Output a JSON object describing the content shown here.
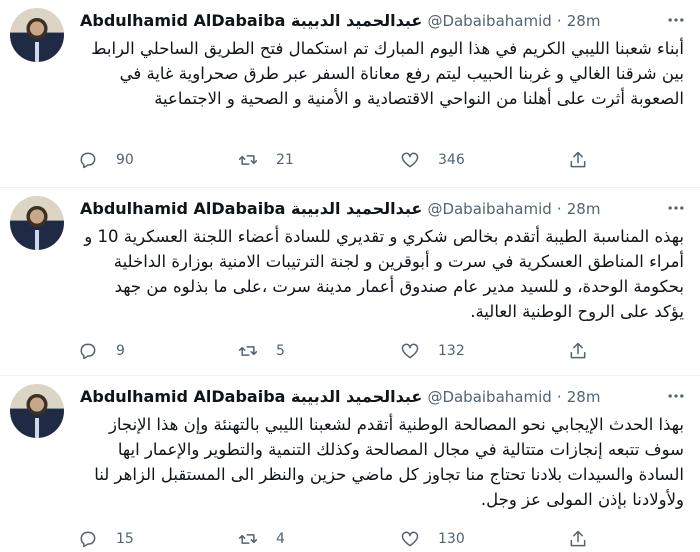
{
  "tweets": [
    {
      "author_name": "Abdulhamid AlDabaiba عبدالحميد الدبيبة",
      "handle": "@Dabaibahamid",
      "separator": "·",
      "time": "28m",
      "text": "أبناء شعبنا الليبي الكريم في هذا اليوم المبارك تم استكمال فتح الطريق الساحلي الرابط بين شرقنا الغالي و غربنا الحبيب ليتم رفع معاناة السفر عبر طرق صحراوية غاية في الصعوبة أثرت على أهلنا من النواحي الاقتصادية و الأمنية و الصحية و الاجتماعية",
      "replies": "90",
      "retweets": "21",
      "likes": "346"
    },
    {
      "author_name": "Abdulhamid AlDabaiba عبدالحميد الدبيبة",
      "handle": "@Dabaibahamid",
      "separator": "·",
      "time": "28m",
      "text": "بهذه المناسبة الطيبة أتقدم بخالص شكري و تقديري للسادة أعضاء اللجنة العسكرية 10 و أمراء المناطق العسكرية في سرت و أبوقرين و لجنة الترتيبات الامنية بوزارة الداخلية بحكومة الوحدة، و للسيد مدير عام صندوق أعمار مدينة سرت ،على ما بذلوه من جهد  يؤكد على الروح الوطنية العالية.",
      "replies": "9",
      "retweets": "5",
      "likes": "132"
    },
    {
      "author_name": "Abdulhamid AlDabaiba عبدالحميد الدبيبة",
      "handle": "@Dabaibahamid",
      "separator": "·",
      "time": "28m",
      "text": "بهذا الحدث الإيجابي نحو المصالحة الوطنية أتقدم لشعبنا الليبي بالتهنئة وإن هذا الإنجاز سوف تتبعه إنجازات متتالية في مجال المصالحة وكذلك التنمية والتطوير والإعمار ايها السادة والسيدات بلادنا تحتاج منا تجاوز كل ماضي حزين والنظر الى المستقبل الزاهر لنا ولأولادنا بإذن المولى عز وجل.",
      "replies": "15",
      "retweets": "4",
      "likes": "130"
    }
  ],
  "icons": {
    "reply": "reply-icon",
    "retweet": "retweet-icon",
    "like": "heart-icon",
    "share": "share-icon",
    "more": "more-icon"
  },
  "colors": {
    "text": "#0f1419",
    "secondary": "#536471",
    "divider": "#eff3f4"
  }
}
